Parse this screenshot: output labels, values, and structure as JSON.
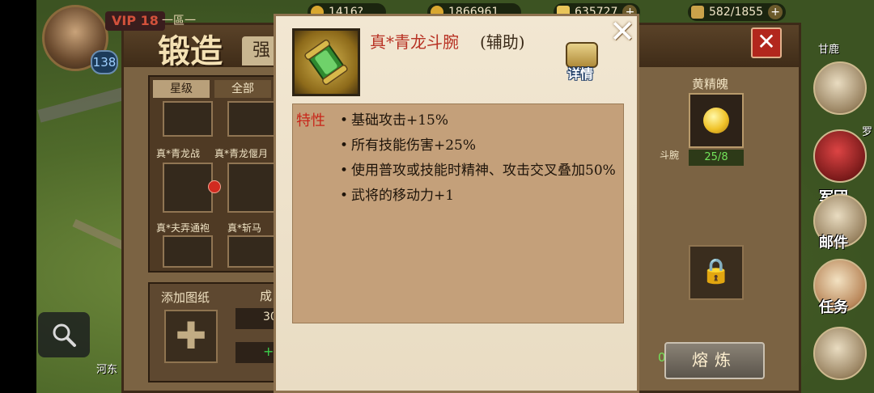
{
  "topbar": {
    "vip_label": "VIP 18",
    "player_level": "138",
    "server_name": "一區一",
    "resources": [
      {
        "name": "silver",
        "value": "1416?",
        "icon": "coin-icon"
      },
      {
        "name": "copper",
        "value": "1866961",
        "icon": "coin-icon"
      },
      {
        "name": "gold",
        "value": "635727",
        "icon": "ingot-icon"
      },
      {
        "name": "food",
        "value": "582/1855",
        "icon": "grain-icon"
      }
    ],
    "plus": "+"
  },
  "forge": {
    "title": "锻造",
    "tab_label": "强",
    "close": "✕",
    "filters": [
      "星级",
      "全部"
    ],
    "items": [
      {
        "label": "真*青龙战"
      },
      {
        "label": "真*青龙偃月"
      },
      {
        "label": "真*夫弄通袍"
      },
      {
        "label": "真*斩马"
      }
    ],
    "add_blueprint_label": "添加图纸",
    "add_slot_glyph": "✚",
    "success_label": "成",
    "field_value": "30",
    "green_plus": "+",
    "soul_label": "黄精魄",
    "soul_count": "25/8",
    "soul_partial": "0",
    "lock_glyph": "🔒",
    "smelt_label": "熔炼",
    "side_partial_label": "斗腕"
  },
  "side_menu": [
    {
      "label": "",
      "icon": "book-icon"
    },
    {
      "label": "军团",
      "icon": "helmet-icon"
    },
    {
      "label": "邮件",
      "icon": "mail-icon"
    },
    {
      "label": "任务",
      "icon": "scroll-icon"
    },
    {
      "label": "",
      "icon": "book-icon"
    }
  ],
  "map_labels": {
    "left_bottom": "河东",
    "right_top": "甘鹿",
    "right_mid": "罗"
  },
  "modal": {
    "title": "真*青龙斗腕",
    "category": "(辅助)",
    "detail_label": "详情",
    "close": "✕",
    "traits_label": "特性",
    "traits": [
      "基础攻击+15%",
      "所有技能伤害+25%",
      "使用普攻或技能时精神、攻击交叉叠加50%",
      "武将的移动力+1"
    ]
  },
  "colors": {
    "title_red": "#b83224",
    "panel_tan": "#c4a07a",
    "modal_bg": "#f2e7d2",
    "close_red": "#b2271d"
  }
}
